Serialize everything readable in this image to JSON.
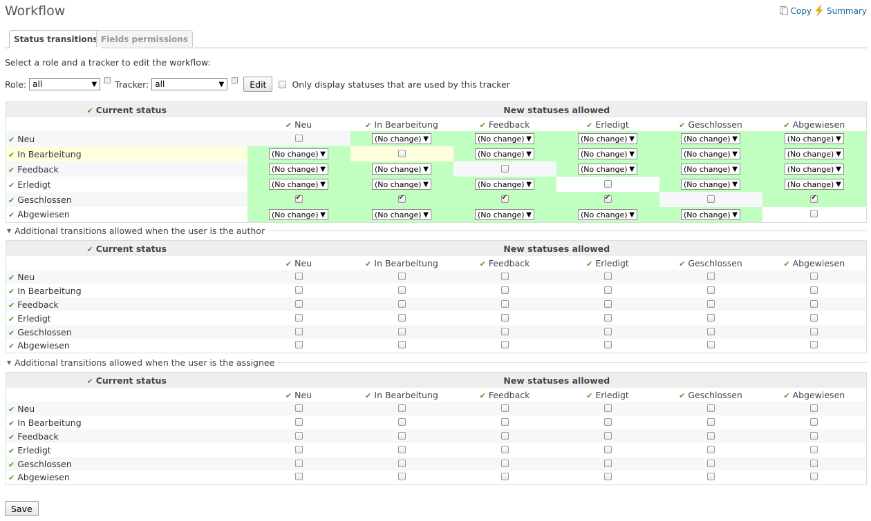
{
  "page": {
    "title": "Workflow"
  },
  "toplinks": {
    "copy": "Copy",
    "summary": "Summary"
  },
  "tabs": [
    {
      "label": "Status transitions"
    },
    {
      "label": "Fields permissions"
    }
  ],
  "intro": "Select a role and a tracker to edit the workflow:",
  "filters": {
    "role_label": "Role:",
    "role_value": "all",
    "tracker_label": "Tracker:",
    "tracker_value": "all",
    "edit_label": "Edit",
    "only_used_label": "Only display statuses that are used by this tracker"
  },
  "table": {
    "current_status": "Current status",
    "new_statuses": "New statuses allowed",
    "statuses": [
      "Neu",
      "In Bearbeitung",
      "Feedback",
      "Erledigt",
      "Geschlossen",
      "Abgewiesen"
    ],
    "no_change": "(No change)"
  },
  "main_matrix": [
    [
      "cb",
      "sel",
      "sel",
      "sel",
      "sel",
      "sel"
    ],
    [
      "sel",
      "cb",
      "sel",
      "sel",
      "sel",
      "sel"
    ],
    [
      "sel",
      "sel",
      "cb",
      "sel",
      "sel",
      "sel"
    ],
    [
      "sel",
      "sel",
      "sel",
      "cb",
      "sel",
      "sel"
    ],
    [
      "on",
      "on",
      "on",
      "on",
      "cb",
      "on"
    ],
    [
      "sel",
      "sel",
      "sel",
      "sel",
      "sel",
      "cb"
    ]
  ],
  "sections": {
    "author": "Additional transitions allowed when the user is the author",
    "assignee": "Additional transitions allowed when the user is the assignee"
  },
  "save_label": "Save",
  "colors": {
    "allowed": "#c0ffc0",
    "current": "#ffffdd",
    "check": "#4a9c2a",
    "link": "#116699"
  }
}
